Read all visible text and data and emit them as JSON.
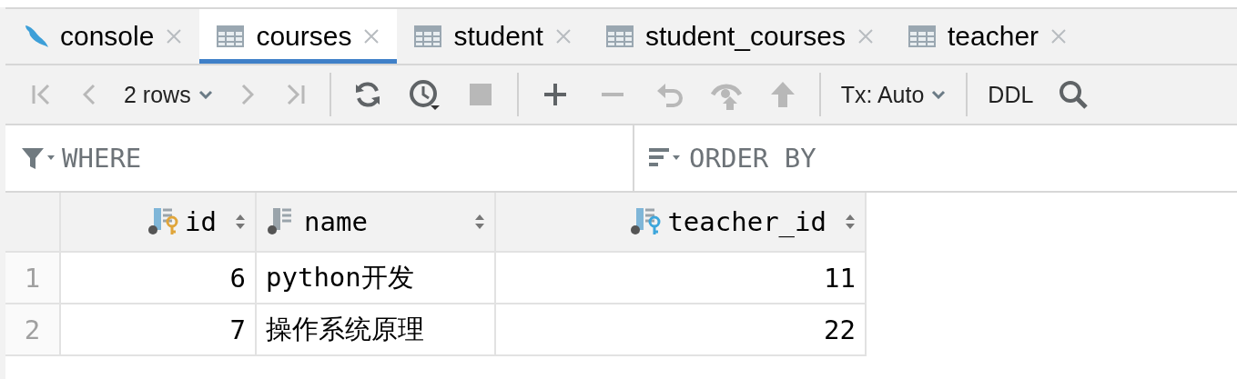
{
  "tabs": [
    {
      "label": "console",
      "kind": "console",
      "selected": false
    },
    {
      "label": "courses",
      "kind": "table",
      "selected": true
    },
    {
      "label": "student",
      "kind": "table",
      "selected": false
    },
    {
      "label": "student_courses",
      "kind": "table",
      "selected": false
    },
    {
      "label": "teacher",
      "kind": "table",
      "selected": false
    }
  ],
  "toolbar": [
    {
      "kind": "first",
      "disabled": true
    },
    {
      "kind": "prev",
      "disabled": true
    },
    {
      "kind": "rows",
      "label": "2 rows",
      "disabled": false
    },
    {
      "kind": "next",
      "disabled": true
    },
    {
      "kind": "last",
      "disabled": true
    },
    {
      "kind": "sep"
    },
    {
      "kind": "refresh",
      "disabled": false
    },
    {
      "kind": "history",
      "disabled": false
    },
    {
      "kind": "stop",
      "disabled": true
    },
    {
      "kind": "sep"
    },
    {
      "kind": "add",
      "disabled": false
    },
    {
      "kind": "remove",
      "disabled": true
    },
    {
      "kind": "revert",
      "disabled": true
    },
    {
      "kind": "preview",
      "disabled": true
    },
    {
      "kind": "submit",
      "disabled": true
    },
    {
      "kind": "sep"
    },
    {
      "kind": "tx",
      "label": "Tx: Auto",
      "disabled": false
    },
    {
      "kind": "sep"
    },
    {
      "kind": "ddl",
      "label": "DDL",
      "disabled": false
    },
    {
      "kind": "search"
    }
  ],
  "filter": {
    "where_placeholder": "WHERE",
    "order_placeholder": "ORDER BY"
  },
  "table": {
    "columns": [
      {
        "name": "id",
        "kind": "primary"
      },
      {
        "name": "name",
        "kind": "plain"
      },
      {
        "name": "teacher_id",
        "kind": "foreign"
      }
    ],
    "rows": [
      {
        "number": "1",
        "cells": [
          "6",
          "python开发",
          "11"
        ]
      },
      {
        "number": "2",
        "cells": [
          "7",
          "操作系统原理",
          "22"
        ]
      }
    ]
  }
}
